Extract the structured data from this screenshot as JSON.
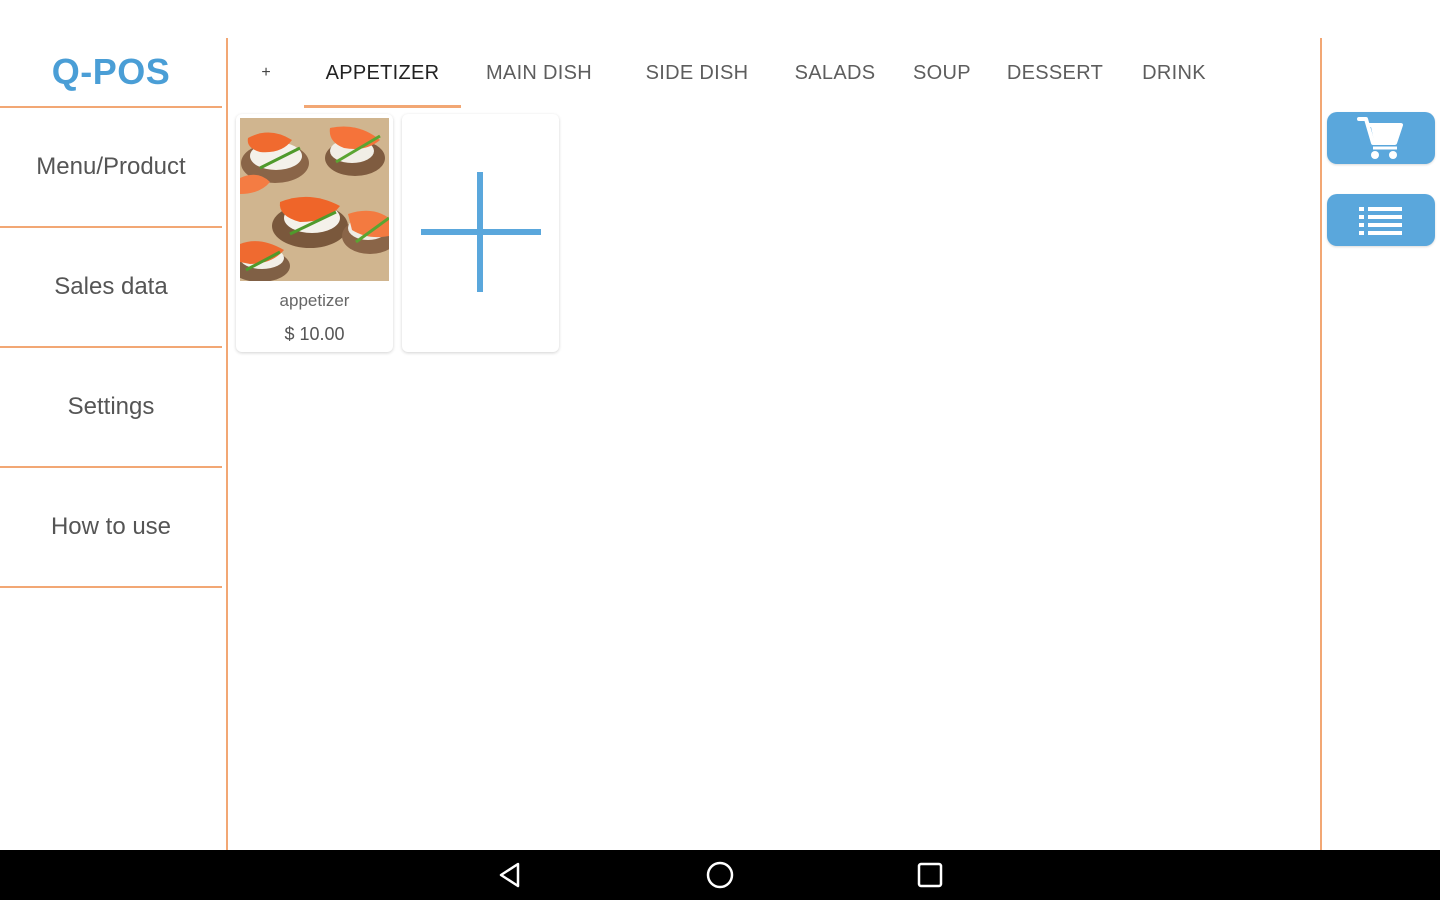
{
  "sidebar": {
    "logo": "Q-POS",
    "items": [
      {
        "label": "Menu/Product"
      },
      {
        "label": "Sales data"
      },
      {
        "label": "Settings"
      },
      {
        "label": "How to use"
      }
    ]
  },
  "tabs": {
    "add_symbol": "+",
    "items": [
      {
        "label": "APPETIZER",
        "active": true
      },
      {
        "label": "MAIN DISH"
      },
      {
        "label": "SIDE DISH"
      },
      {
        "label": "SALADS"
      },
      {
        "label": "SOUP"
      },
      {
        "label": "DESSERT"
      },
      {
        "label": "DRINK"
      }
    ]
  },
  "products": [
    {
      "name": "appetizer",
      "price": "$ 10.00",
      "image": "salmon-canape-photo"
    }
  ],
  "add_product": {
    "icon": "plus-icon"
  },
  "side_buttons": {
    "cart": {
      "icon": "cart-icon"
    },
    "list": {
      "icon": "list-icon"
    }
  },
  "android_nav": {
    "back": "back-icon",
    "home": "home-icon",
    "recents": "recents-icon"
  },
  "colors": {
    "accent": "#f2a774",
    "brand_blue": "#4a9ed6",
    "button_blue": "#5aa7dc"
  }
}
